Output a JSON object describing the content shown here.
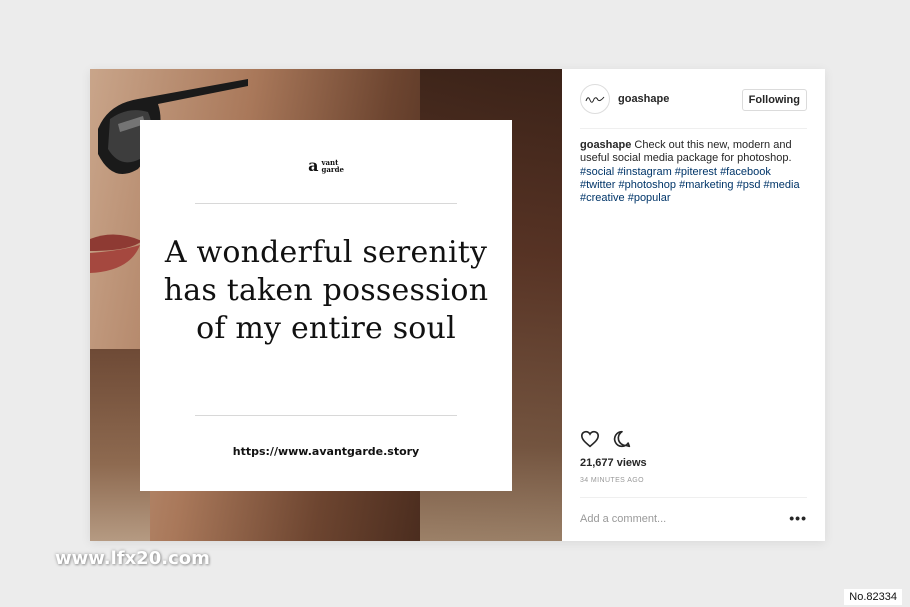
{
  "post": {
    "quote": "A wonderful serenity has taken possession of my entire soul",
    "logo": {
      "letter": "a",
      "line1": "vant",
      "line2": "garde"
    },
    "url": "https://www.avantgarde.story"
  },
  "sidebar": {
    "username": "goashape",
    "follow_label": "Following",
    "caption_user": "goashape",
    "caption_text": " Check out this new, modern and useful social media package for photoshop. ",
    "hashtags": [
      "#social",
      "#instagram",
      "#piterest",
      "#facebook",
      "#twitter",
      "#photoshop",
      "#marketing",
      "#psd",
      "#media",
      "#creative",
      "#popular"
    ],
    "views": "21,677 views",
    "time": "34 MINUTES AGO",
    "comment_placeholder": "Add a comment...",
    "more_label": "•••"
  },
  "icons": {
    "like": "heart-icon",
    "comment": "comment-bubble-icon",
    "more": "more-dots-icon"
  },
  "colors": {
    "hashtag": "#003569",
    "text": "#262626",
    "muted": "#999999"
  },
  "watermark": "www.lfx20.com",
  "badge": "No.82334"
}
